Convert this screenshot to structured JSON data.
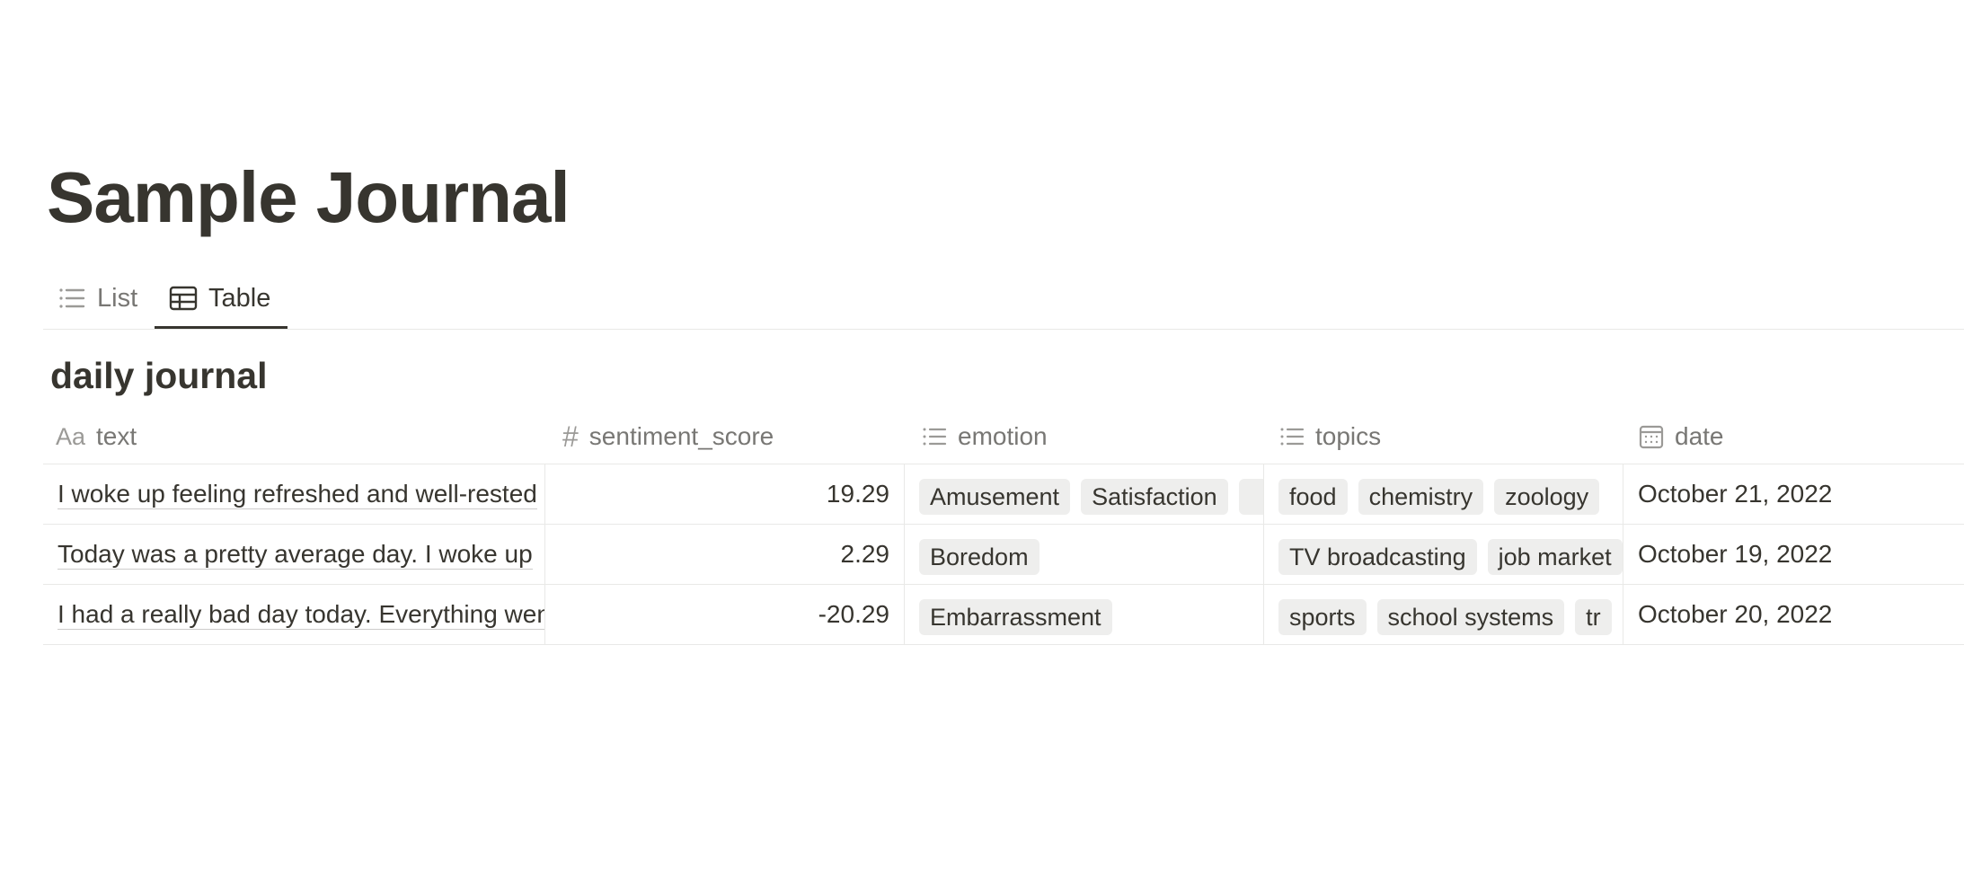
{
  "page": {
    "title": "Sample Journal"
  },
  "views": [
    {
      "label": "List",
      "icon": "list-icon",
      "active": false
    },
    {
      "label": "Table",
      "icon": "table-icon",
      "active": true
    }
  ],
  "database": {
    "title": "daily journal",
    "columns": [
      {
        "label": "text",
        "icon": "Aa"
      },
      {
        "label": "sentiment_score",
        "icon": "#"
      },
      {
        "label": "emotion",
        "icon": "list-icon"
      },
      {
        "label": "topics",
        "icon": "list-icon"
      },
      {
        "label": "date",
        "icon": "calendar-icon"
      }
    ],
    "rows": [
      {
        "text": "I woke up feeling refreshed and well-rested",
        "sentiment_score": "19.29",
        "emotion": [
          "Amusement",
          "Satisfaction",
          ""
        ],
        "topics": [
          "food",
          "chemistry",
          "zoology"
        ],
        "date": "October 21, 2022"
      },
      {
        "text": "Today was a pretty average day. I woke up",
        "sentiment_score": "2.29",
        "emotion": [
          "Boredom"
        ],
        "topics": [
          "TV broadcasting",
          "job market"
        ],
        "date": "October 19, 2022"
      },
      {
        "text": "I had a really bad day today. Everything went",
        "sentiment_score": "-20.29",
        "emotion": [
          "Embarrassment"
        ],
        "topics": [
          "sports",
          "school systems",
          "tr"
        ],
        "date": "October 20, 2022"
      }
    ]
  }
}
